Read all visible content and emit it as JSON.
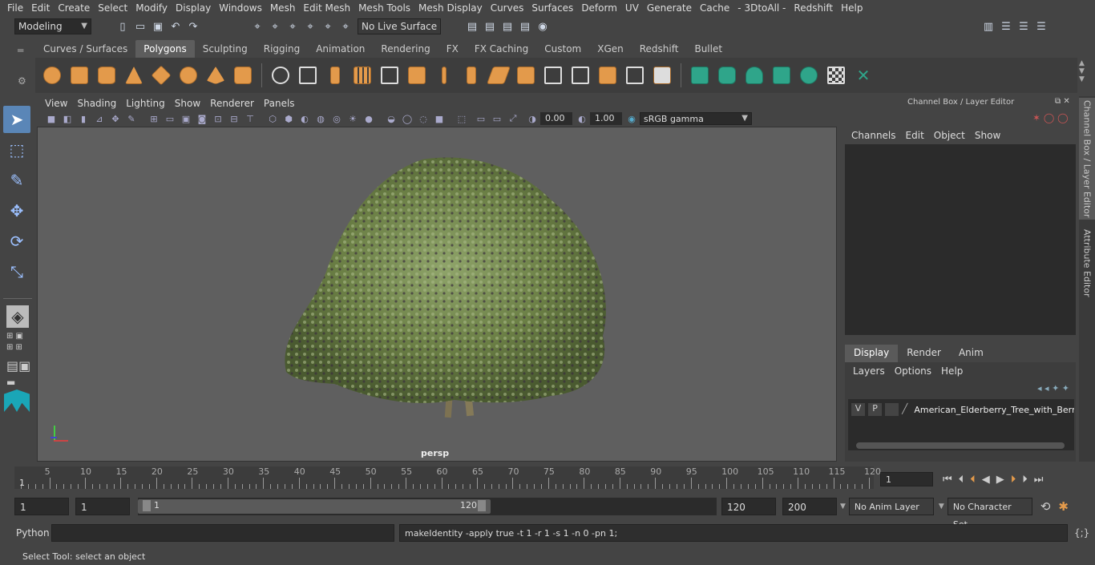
{
  "menu": [
    "File",
    "Edit",
    "Create",
    "Select",
    "Modify",
    "Display",
    "Windows",
    "Mesh",
    "Edit Mesh",
    "Mesh Tools",
    "Mesh Display",
    "Curves",
    "Surfaces",
    "Deform",
    "UV",
    "Generate",
    "Cache",
    "- 3DtoAll -",
    "Redshift",
    "Help"
  ],
  "status": {
    "mode": "Modeling",
    "live_surface": "No Live Surface"
  },
  "shelf_tabs": [
    "Curves / Surfaces",
    "Polygons",
    "Sculpting",
    "Rigging",
    "Animation",
    "Rendering",
    "FX",
    "FX Caching",
    "Custom",
    "XGen",
    "Redshift",
    "Bullet"
  ],
  "shelf_active": "Polygons",
  "viewport": {
    "menus": [
      "View",
      "Shading",
      "Lighting",
      "Show",
      "Renderer",
      "Panels"
    ],
    "exposure": "0.00",
    "gamma": "1.00",
    "colorspace": "sRGB gamma",
    "camera": "persp"
  },
  "channel_box": {
    "title": "Channel Box / Layer Editor",
    "menus": [
      "Channels",
      "Edit",
      "Object",
      "Show"
    ],
    "display_tabs": [
      "Display",
      "Render",
      "Anim"
    ],
    "layer_menus": [
      "Layers",
      "Options",
      "Help"
    ],
    "layer": {
      "v": "V",
      "p": "P",
      "name": "American_Elderberry_Tree_with_Berrie"
    }
  },
  "side_tabs": [
    "Channel Box / Layer Editor",
    "Attribute Editor"
  ],
  "timeline": {
    "ticks": [
      5,
      10,
      15,
      20,
      25,
      30,
      35,
      40,
      45,
      50,
      55,
      60,
      65,
      70,
      75,
      80,
      85,
      90,
      95,
      100,
      105,
      110,
      115,
      120
    ],
    "start_label": "1",
    "current_frame": "1"
  },
  "range": {
    "start": "1",
    "start2": "1",
    "slider_start": "1",
    "slider_end": "120",
    "end": "120",
    "end2": "200",
    "anim_layer": "No Anim Layer",
    "char_set": "No Character Set"
  },
  "command": {
    "lang": "Python",
    "output": "makeIdentity -apply true -t 1 -r 1 -s 1 -n 0 -pn 1;"
  },
  "help": "Select Tool: select an object",
  "colors": {
    "accent": "#5a86b7",
    "shelf_orange": "#e39a4b",
    "shelf_green": "#2fa58a"
  }
}
